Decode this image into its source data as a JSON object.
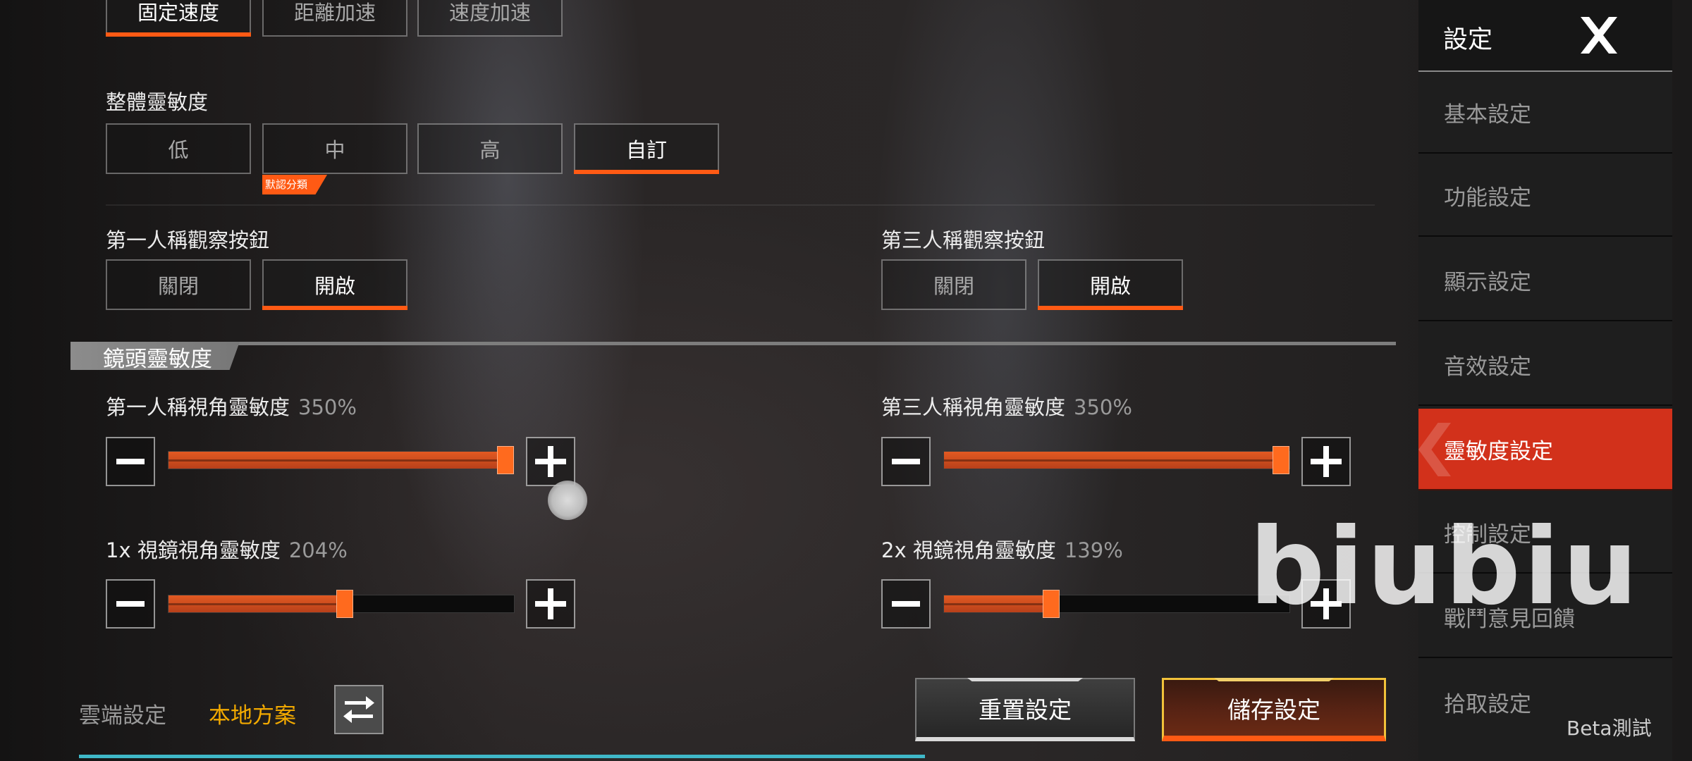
{
  "accel": {
    "options": [
      "固定速度",
      "距離加速",
      "速度加速"
    ],
    "selected": 0
  },
  "overall": {
    "title": "整體靈敏度",
    "options": [
      "低",
      "中",
      "高",
      "自訂"
    ],
    "selected": 3,
    "tag": "默認分類"
  },
  "fp_view": {
    "title": "第一人稱觀察按鈕",
    "options": [
      "關閉",
      "開啟"
    ],
    "selected": 1
  },
  "tp_view": {
    "title": "第三人稱觀察按鈕",
    "options": [
      "關閉",
      "開啟"
    ],
    "selected": 1
  },
  "section_title": "鏡頭靈敏度",
  "sliders": [
    {
      "label": "第一人稱視角靈敏度",
      "value": "350%",
      "fraction": 1.0
    },
    {
      "label": "第三人稱視角靈敏度",
      "value": "350%",
      "fraction": 1.0
    },
    {
      "label": "1x 視鏡視角靈敏度",
      "value": "204%",
      "fraction": 0.51
    },
    {
      "label": "2x 視鏡視角靈敏度",
      "value": "139%",
      "fraction": 0.3
    }
  ],
  "footer": {
    "cloud_label": "雲端設定",
    "local_label": "本地方案",
    "reset": "重置設定",
    "save": "儲存設定"
  },
  "sidebar": {
    "title": "設定",
    "items": [
      "基本設定",
      "功能設定",
      "顯示設定",
      "音效設定",
      "靈敏度設定",
      "控制設定",
      "戰鬥意見回饋",
      "拾取設定"
    ],
    "active": 4,
    "beta": "Beta測試"
  },
  "watermark": "biubiu",
  "colors": {
    "accent": "#ff5a14",
    "active_tab": "#d2311b",
    "local_plan": "#f2a900"
  }
}
